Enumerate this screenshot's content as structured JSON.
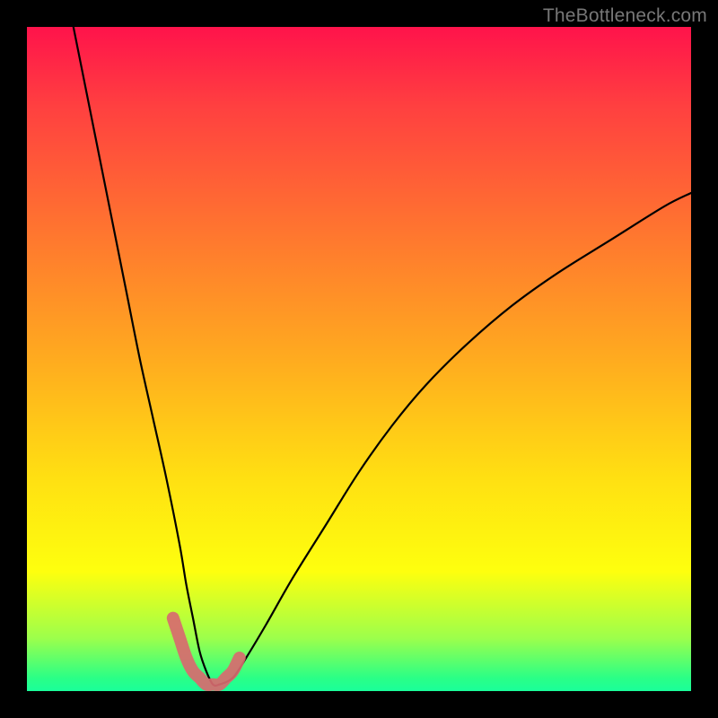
{
  "watermark": "TheBottleneck.com",
  "chart_data": {
    "type": "line",
    "title": "",
    "xlabel": "",
    "ylabel": "",
    "xlim": [
      0,
      100
    ],
    "ylim": [
      0,
      100
    ],
    "grid": false,
    "legend": false,
    "series": [
      {
        "name": "bottleneck-curve",
        "x": [
          7,
          9,
          11,
          13,
          15,
          17,
          19,
          21,
          23,
          24,
          25,
          26,
          27,
          28,
          29,
          31,
          33,
          36,
          40,
          45,
          50,
          55,
          60,
          66,
          73,
          80,
          88,
          96,
          100
        ],
        "y": [
          100,
          90,
          80,
          70,
          60,
          50,
          41,
          32,
          22,
          16,
          11,
          6,
          3,
          1,
          1,
          2,
          5,
          10,
          17,
          25,
          33,
          40,
          46,
          52,
          58,
          63,
          68,
          73,
          75
        ]
      },
      {
        "name": "highlight-band",
        "x": [
          22,
          23,
          24,
          25,
          26,
          27,
          28,
          29,
          30,
          31,
          32
        ],
        "y": [
          11,
          8,
          5,
          3,
          2,
          1,
          1,
          1,
          2,
          3,
          5
        ]
      }
    ],
    "gradient_stops": [
      {
        "pos": 0,
        "color": "#ff134b"
      },
      {
        "pos": 50,
        "color": "#ffab1f"
      },
      {
        "pos": 82,
        "color": "#feff0e"
      },
      {
        "pos": 100,
        "color": "#1aff9a"
      }
    ]
  }
}
